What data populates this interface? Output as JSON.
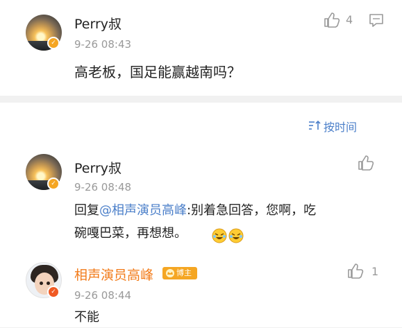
{
  "top_comment": {
    "author": "Perry叔",
    "time": "9-26 08:43",
    "text": "高老板，国足能赢越南吗？",
    "like_count": "4",
    "icons": {
      "like": "thumbs-up-icon",
      "comment": "comment-icon",
      "badge": "verified-badge-icon"
    }
  },
  "sort_bar": {
    "label": "按时间",
    "icon": "sort-icon"
  },
  "replies": [
    {
      "author": "Perry叔",
      "time": "9-26 08:48",
      "text_prefix": "回复",
      "mention": "@相声演员高峰",
      "text_main": ":别着急回答，您啊，吃",
      "text_line2": "碗嘎巴菜，再想想。",
      "emoji": "laughing-emoji",
      "like_count": ""
    },
    {
      "author": "相声演员高峰",
      "badge_label": "博主",
      "time": "9-26 08:44",
      "text": "不能",
      "like_count": "1"
    }
  ],
  "colors": {
    "link_blue": "#4b7fc9",
    "host_orange": "#f27b1a",
    "badge_gold": "#f5a623",
    "muted_gray": "#999999",
    "separator_gray": "#f1f1f1"
  }
}
